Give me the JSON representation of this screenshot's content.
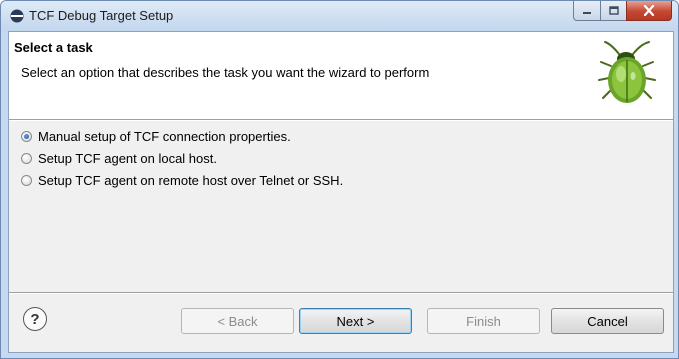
{
  "window": {
    "title": "TCF Debug Target Setup",
    "controls": {
      "minimize": "minimize",
      "maximize": "maximize",
      "close": "close"
    }
  },
  "header": {
    "title": "Select a task",
    "description": "Select an option that describes the task you want the wizard to perform",
    "icon": "bug-icon"
  },
  "options": [
    {
      "label": "Manual setup of TCF connection properties.",
      "selected": true
    },
    {
      "label": "Setup TCF agent on local host.",
      "selected": false
    },
    {
      "label": "Setup TCF agent on remote host over Telnet or SSH.",
      "selected": false
    }
  ],
  "footer": {
    "help_label": "?",
    "back_label": "< Back",
    "next_label": "Next >",
    "finish_label": "Finish",
    "cancel_label": "Cancel"
  },
  "colors": {
    "title_bar": "#c2d6ee",
    "close_button": "#c54733",
    "dialog_bg": "#f0f0f0",
    "default_button_border": "#3c7fb1"
  }
}
